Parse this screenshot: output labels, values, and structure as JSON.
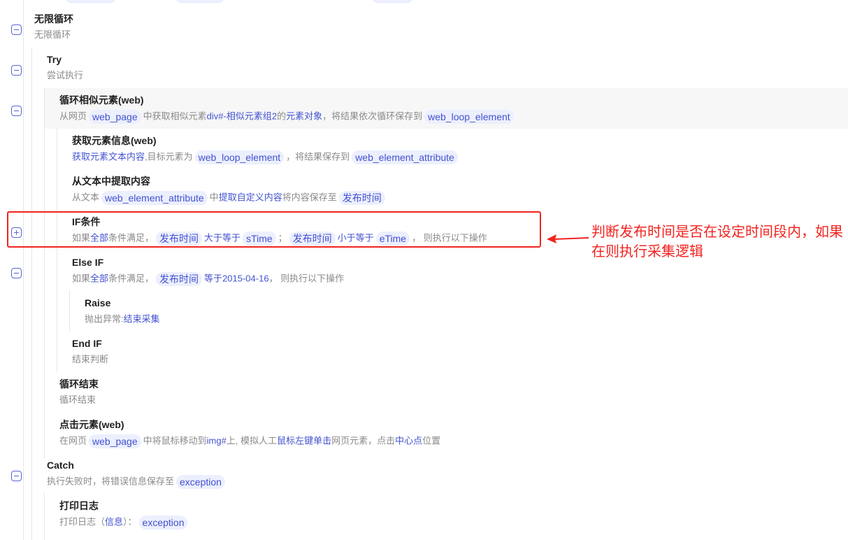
{
  "colors": {
    "accent": "#4352d0",
    "annotation": "#f2231f"
  },
  "steps": {
    "loop_infinite": {
      "title": "无限循环",
      "desc": "无限循环"
    },
    "try": {
      "title": "Try",
      "desc": "尝试执行"
    },
    "loop_similar": {
      "title": "循环相似元素(web)",
      "d1": "从网页",
      "c1": "web_page",
      "d2": "中获取相似元素",
      "k1": "div#-相似元素组2",
      "d3": "的",
      "k2": "元素对象",
      "d4": "，将结果依次循环保存到",
      "c2": "web_loop_element"
    },
    "get_attr": {
      "title": "获取元素信息(web)",
      "k1": "获取元素文本内容",
      "d1": ",目标元素为",
      "c1": "web_loop_element",
      "d2": "，将结果保存到",
      "c2": "web_element_attribute"
    },
    "extract": {
      "title": "从文本中提取内容",
      "d1": "从文本",
      "c1": "web_element_attribute",
      "d2": "中",
      "k1": "提取自定义内容",
      "d3": "将内容保存至",
      "c2": "发布时间"
    },
    "if_cond": {
      "title": "IF条件",
      "d1": "如果",
      "k1": "全部",
      "d2": "条件满足，",
      "c1": "发布时间",
      "k2": "大于等于",
      "c2": "sTime",
      "d3": "；",
      "c3": "发布时间",
      "k3": "小于等于",
      "c4": "eTime",
      "d4": "，  则执行以下操作"
    },
    "else_if": {
      "title": "Else IF",
      "d1": "如果",
      "k1": "全部",
      "d2": "条件满足，",
      "c1": "发布时间",
      "k2": "等于",
      "k3": "2015-04-16",
      "d3": "，  则执行以下操作"
    },
    "raise": {
      "title": "Raise",
      "d1": "抛出异常:",
      "k1": "结束采集"
    },
    "end_if": {
      "title": "End IF",
      "desc": "结束判断"
    },
    "loop_end": {
      "title": "循环结束",
      "desc": "循环结束"
    },
    "click": {
      "title": "点击元素(web)",
      "d1": "在网页",
      "c1": "web_page",
      "d2": "中将鼠标移动到",
      "k1": "img#",
      "d3": "上, 模拟人工",
      "k2": "鼠标左键",
      "k3": "单击",
      "d4": "网页元素，点击",
      "k4": "中心点",
      "d5": "位置"
    },
    "catch": {
      "title": "Catch",
      "d1": "执行失败时，将错误信息保存至",
      "c1": "exception"
    },
    "print_log": {
      "title": "打印日志",
      "d1": "打印日志（",
      "k1": "信息",
      "d2": "）：",
      "c1": "exception"
    }
  },
  "annotation": {
    "text": "判断发布时间是否在设定时间段内，如果在则执行采集逻辑"
  }
}
